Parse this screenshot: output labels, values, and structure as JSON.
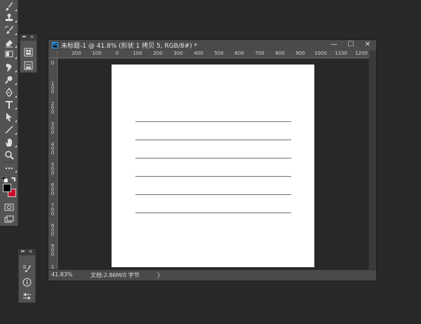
{
  "document": {
    "title": "未标题-1 @ 41.8% (形状 1 拷贝 5, RGB/8#) *",
    "app_icon_text": "Ps",
    "controls": {
      "minimize": "—",
      "maximize": "☐",
      "close": "✕"
    }
  },
  "ruler": {
    "h_ticks": [
      "200",
      "100",
      "0",
      "100",
      "200",
      "300",
      "400",
      "500",
      "600",
      "700",
      "800",
      "900",
      "1000",
      "1100",
      "1200"
    ],
    "v_ticks": [
      "0",
      "100",
      "200",
      "300",
      "400",
      "500",
      "600",
      "700",
      "800",
      "900",
      "1"
    ]
  },
  "status": {
    "zoom": "41.83%",
    "doc_info": "文档:2.86M/0 字节",
    "arrow": "〉"
  },
  "canvas": {
    "background": "#ffffff",
    "line_color": "#6e6e6e",
    "line_count": 6
  },
  "colors": {
    "foreground": "#000000",
    "background": "#c8102e",
    "ui_panel": "#535353",
    "workspace": "#282828"
  },
  "tools": [
    "brush-icon",
    "stamp-icon",
    "history-brush-icon",
    "eraser-icon",
    "gradient-icon",
    "blur-icon",
    "dodge-icon",
    "pen-icon",
    "type-icon",
    "path-select-icon",
    "line-icon",
    "hand-icon",
    "zoom-icon",
    "more-icon"
  ],
  "dock_top": [
    "properties-icon",
    "adjustments-icon"
  ],
  "dock_bottom": [
    "brush-settings-icon",
    "info-icon",
    "layer-comps-icon"
  ]
}
